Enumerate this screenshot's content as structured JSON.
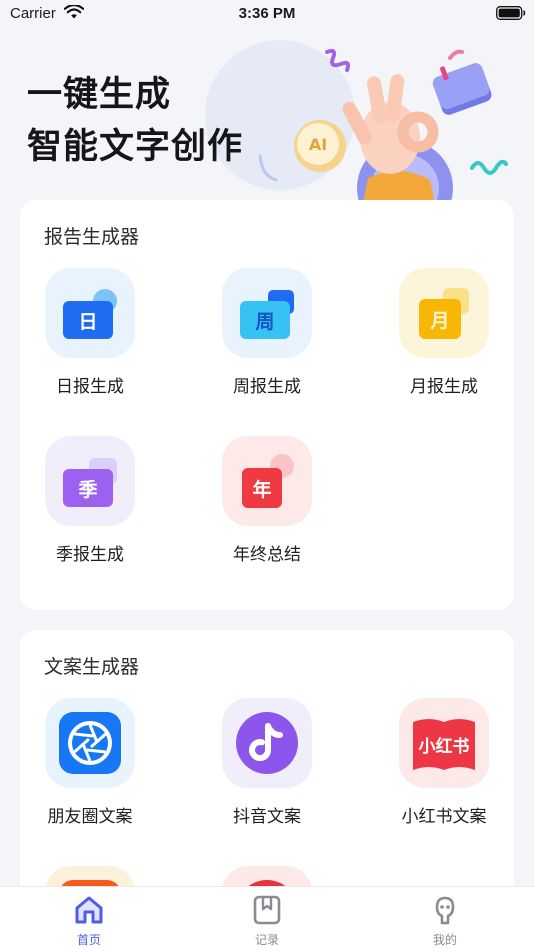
{
  "status_bar": {
    "carrier": "Carrier",
    "time": "3:36 PM"
  },
  "hero": {
    "line1": "一键生成",
    "line2": "智能文字创作",
    "badge": "AI"
  },
  "report_section": {
    "title": "报告生成器",
    "items": [
      {
        "label": "日报生成",
        "glyph": "日",
        "color": "#1f6bf2",
        "bg": "#e9f3fd"
      },
      {
        "label": "周报生成",
        "glyph": "周",
        "color": "#37c2f4",
        "bg": "#e9f3fd"
      },
      {
        "label": "月报生成",
        "glyph": "月",
        "color": "#f8b707",
        "bg": "#fdf5d9"
      },
      {
        "label": "季报生成",
        "glyph": "季",
        "color": "#9a62ef",
        "bg": "#f1eefb"
      },
      {
        "label": "年终总结",
        "glyph": "年",
        "color": "#f03a43",
        "bg": "#fde9e8"
      }
    ]
  },
  "copy_section": {
    "title": "文案生成器",
    "items": [
      {
        "label": "朋友圈文案",
        "icon": "camera-shutter-icon",
        "color": "#1678f5",
        "bg": "#e9f3fd"
      },
      {
        "label": "抖音文案",
        "icon": "music-note-icon",
        "color": "#8c55eb",
        "bg": "#f1eefb"
      },
      {
        "label": "小红书文案",
        "glyph": "小红书",
        "icon": "book-icon",
        "color": "#ee3744",
        "bg": "#fde9e8"
      }
    ]
  },
  "tabbar": {
    "items": [
      {
        "label": "首页",
        "icon": "home-icon",
        "active": true
      },
      {
        "label": "记录",
        "icon": "bookmark-icon",
        "active": false
      },
      {
        "label": "我的",
        "icon": "profile-icon",
        "active": false
      }
    ]
  }
}
